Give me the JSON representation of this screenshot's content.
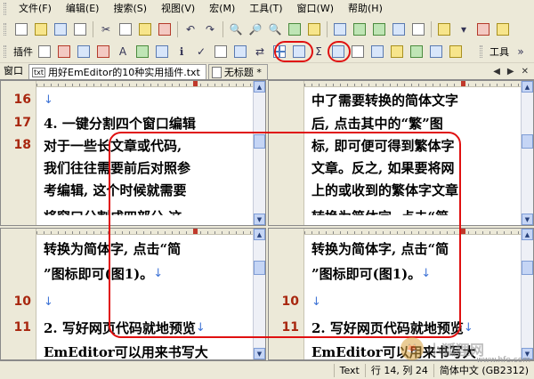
{
  "menu": [
    "文件(F)",
    "编辑(E)",
    "搜索(S)",
    "视图(V)",
    "宏(M)",
    "工具(T)",
    "窗口(W)",
    "帮助(H)"
  ],
  "toolbar2": {
    "plugin_label": "插件",
    "tools_label": "工具"
  },
  "tabs": {
    "window_label": "窗口",
    "items": [
      {
        "label": "用好EmEditor的10种实用插件.txt",
        "icon": "txt"
      },
      {
        "label": "无标题 *"
      }
    ]
  },
  "panes": {
    "top_left": [
      {
        "num": "16",
        "text": ""
      },
      {
        "num": "17",
        "text": "4. 一键分割四个窗口编辑"
      },
      {
        "num": "18",
        "text": "对于一些长文章或代码,"
      },
      {
        "num": "",
        "text": "我们往往需要前后对照参"
      },
      {
        "num": "",
        "text": "考编辑, 这个时候就需要"
      },
      {
        "num": "",
        "text": "将窗口分割成四部分,这"
      }
    ],
    "top_right": [
      {
        "num": "",
        "text": "中了需要转换的简体文字"
      },
      {
        "num": "",
        "text": "后, 点击其中的“繁”图"
      },
      {
        "num": "",
        "text": "标, 即可便可得到繁体字"
      },
      {
        "num": "",
        "text": "文章。反之, 如果要将网"
      },
      {
        "num": "",
        "text": "上的或收到的繁体字文章"
      },
      {
        "num": "",
        "text": "转换为简体字, 点击“简"
      }
    ],
    "bottom_left": [
      {
        "num": "",
        "text": "转换为简体字, 点击“简"
      },
      {
        "num": "",
        "text": "”图标即可(图1)。"
      },
      {
        "num": "10",
        "text": ""
      },
      {
        "num": "11",
        "text": "2. 写好网页代码就地预览"
      },
      {
        "num": "",
        "text": "EmEditor可以用来书写大"
      }
    ],
    "bottom_right": [
      {
        "num": "",
        "text": "转换为简体字, 点击“简"
      },
      {
        "num": "",
        "text": "”图标即可(图1)。"
      },
      {
        "num": "10",
        "text": ""
      },
      {
        "num": "11",
        "text": "2. 写好网页代码就地预览"
      },
      {
        "num": "",
        "text": "EmEditor可以用来书写大"
      }
    ]
  },
  "status": {
    "mode": "Text",
    "position": "行 14, 列 24",
    "encoding": "简体中文 (GB2312)"
  },
  "watermark": {
    "text": "小狐狸网",
    "url": "www.hfe.com"
  },
  "colors": {
    "line_number": "#a8270f",
    "annotation_ring": "#e01010",
    "return_mark": "#3f74d6"
  }
}
